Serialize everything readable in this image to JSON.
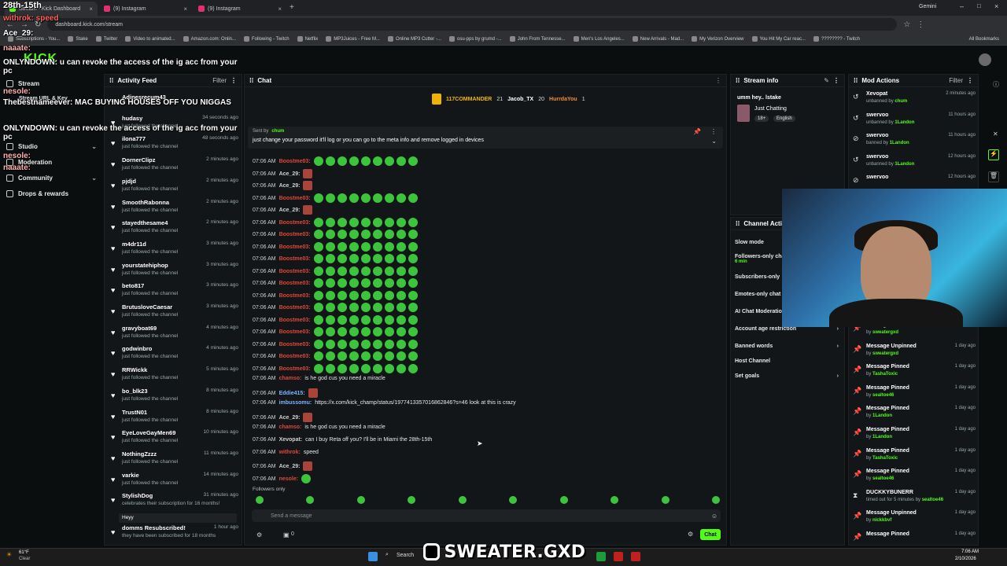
{
  "browser": {
    "tabs": [
      {
        "label": "Stream - Kick Dashboard"
      },
      {
        "label": "(9) Instagram"
      },
      {
        "label": "(9) Instagram"
      }
    ],
    "gemini_label": "Gemini",
    "url": "dashboard.kick.com/stream",
    "bookmarks": [
      "Subscriptions - You...",
      "Stake",
      "Twitter",
      "Video to animated...",
      "Amazon.com: Onlin...",
      "Following - Twitch",
      "Netflix",
      "MP3Juices - Free M...",
      "Online MP3 Cutter -...",
      "osu-pps by grumd -...",
      "John From Tennesse...",
      "Men's Los Angeles...",
      "New Arrivals - Mad...",
      "My Verizon Overview",
      "You Hit My Car reac...",
      "???????? - Twitch"
    ],
    "all_bookmarks": "All Bookmarks"
  },
  "kick": {
    "logo": "KICK"
  },
  "leftnav": {
    "items": [
      {
        "label": "Stream"
      },
      {
        "label": "Stream URL & Key"
      },
      {
        "label": "Studio"
      },
      {
        "label": "Moderation"
      },
      {
        "label": "Community"
      },
      {
        "label": "Drops & rewards"
      }
    ]
  },
  "activity": {
    "title": "Activity Feed",
    "filter": "Filter",
    "items": [
      {
        "name": "Adinesrecum43",
        "sub": "",
        "time": ""
      },
      {
        "name": "hudasy",
        "sub": "just followed the channel",
        "time": "34 seconds ago"
      },
      {
        "name": "ilona777",
        "sub": "just followed the channel",
        "time": "48 seconds ago"
      },
      {
        "name": "DornerClipz",
        "sub": "just followed the channel",
        "time": "2 minutes ago"
      },
      {
        "name": "pjdjd",
        "sub": "just followed the channel",
        "time": "2 minutes ago"
      },
      {
        "name": "SmoothRabonna",
        "sub": "just followed the channel",
        "time": "2 minutes ago"
      },
      {
        "name": "stayedthesame4",
        "sub": "just followed the channel",
        "time": "2 minutes ago"
      },
      {
        "name": "m4dr11d",
        "sub": "just followed the channel",
        "time": "3 minutes ago"
      },
      {
        "name": "yourstatehiphop",
        "sub": "just followed the channel",
        "time": "3 minutes ago"
      },
      {
        "name": "beto817",
        "sub": "just followed the channel",
        "time": "3 minutes ago"
      },
      {
        "name": "BrutusloveCaesar",
        "sub": "just followed the channel",
        "time": "3 minutes ago"
      },
      {
        "name": "gravyboat69",
        "sub": "just followed the channel",
        "time": "4 minutes ago"
      },
      {
        "name": "godwinbro",
        "sub": "just followed the channel",
        "time": "4 minutes ago"
      },
      {
        "name": "RRWickk",
        "sub": "just followed the channel",
        "time": "5 minutes ago"
      },
      {
        "name": "bo_blk23",
        "sub": "just followed the channel",
        "time": "8 minutes ago"
      },
      {
        "name": "TrustN01",
        "sub": "just followed the channel",
        "time": "8 minutes ago"
      },
      {
        "name": "EyeLoveGayMen69",
        "sub": "just followed the channel",
        "time": "10 minutes ago"
      },
      {
        "name": "NothingZzzz",
        "sub": "just followed the channel",
        "time": "11 minutes ago"
      },
      {
        "name": "varkie",
        "sub": "just followed the channel",
        "time": "14 minutes ago"
      },
      {
        "name": "StylishDog",
        "sub": "celebrates their subscription for 16 months!",
        "time": "31 minutes ago"
      },
      {
        "name": "domms Resubscribed!",
        "sub": "they have been subscribed for 18 months",
        "time": "1 hour ago"
      }
    ],
    "stylishdog_msg": "Heyy"
  },
  "chat": {
    "title": "Chat",
    "top_users": [
      {
        "name": "117COMMANDER",
        "count": "21"
      },
      {
        "name": "Jacob_TX",
        "count": "20"
      },
      {
        "name": "HurrdaYou",
        "count": "1"
      }
    ],
    "pinned_by": "Sent by",
    "pinned_user": "chum",
    "pinned_text": "just change your password it'll log or you can go to the meta info and remove logged in devices",
    "messages": [
      {
        "time": "07:06 AM",
        "user": "Boostme03:",
        "text": "",
        "emotes": 9,
        "kind": "emo",
        "color": "#e0463a"
      },
      {
        "time": "07:06 AM",
        "user": "Ace_29:",
        "text": "",
        "emotes": 1,
        "kind": "box",
        "color": "#cfcfcf"
      },
      {
        "time": "07:06 AM",
        "user": "Ace_29:",
        "text": "",
        "emotes": 1,
        "kind": "box",
        "color": "#cfcfcf"
      },
      {
        "time": "07:06 AM",
        "user": "Boostme03:",
        "text": "",
        "emotes": 9,
        "kind": "emo",
        "color": "#e0463a"
      },
      {
        "time": "07:06 AM",
        "user": "Ace_29:",
        "text": "",
        "emotes": 1,
        "kind": "box",
        "color": "#cfcfcf"
      },
      {
        "time": "07:06 AM",
        "user": "Boostme03:",
        "text": "",
        "emotes": 9,
        "kind": "emo",
        "color": "#e0463a"
      },
      {
        "time": "07:06 AM",
        "user": "Boostme03:",
        "text": "",
        "emotes": 9,
        "kind": "emo",
        "color": "#e0463a"
      },
      {
        "time": "07:06 AM",
        "user": "Boostme03:",
        "text": "",
        "emotes": 9,
        "kind": "emo",
        "color": "#e0463a"
      },
      {
        "time": "07:06 AM",
        "user": "Boostme03:",
        "text": "",
        "emotes": 9,
        "kind": "emo",
        "color": "#e0463a"
      },
      {
        "time": "07:06 AM",
        "user": "Boostme03:",
        "text": "",
        "emotes": 9,
        "kind": "emo",
        "color": "#e0463a"
      },
      {
        "time": "07:06 AM",
        "user": "Boostme03:",
        "text": "",
        "emotes": 9,
        "kind": "emo",
        "color": "#e0463a"
      },
      {
        "time": "07:06 AM",
        "user": "Boostme03:",
        "text": "",
        "emotes": 9,
        "kind": "emo",
        "color": "#e0463a"
      },
      {
        "time": "07:06 AM",
        "user": "Boostme03:",
        "text": "",
        "emotes": 9,
        "kind": "emo",
        "color": "#e0463a"
      },
      {
        "time": "07:06 AM",
        "user": "Boostme03:",
        "text": "",
        "emotes": 9,
        "kind": "emo",
        "color": "#e0463a"
      },
      {
        "time": "07:06 AM",
        "user": "Boostme03:",
        "text": "",
        "emotes": 9,
        "kind": "emo",
        "color": "#e0463a"
      },
      {
        "time": "07:06 AM",
        "user": "Boostme03:",
        "text": "",
        "emotes": 9,
        "kind": "emo",
        "color": "#e0463a"
      },
      {
        "time": "07:06 AM",
        "user": "Boostme03:",
        "text": "",
        "emotes": 9,
        "kind": "emo",
        "color": "#e0463a"
      },
      {
        "time": "07:06 AM",
        "user": "Boostme03:",
        "text": "",
        "emotes": 9,
        "kind": "emo",
        "color": "#e0463a"
      },
      {
        "time": "07:06 AM",
        "user": "chamso:",
        "text": "is he god cus you need a miracle",
        "emotes": 0,
        "kind": "",
        "color": "#e0463a"
      },
      {
        "time": "07:06 AM",
        "user": "Eddie415:",
        "text": "",
        "emotes": 1,
        "kind": "box",
        "color": "#7fb2ff"
      },
      {
        "time": "07:06 AM",
        "user": "imbussomu:",
        "text": "https://x.com/kick_champ/status/1977413357016862846?s=46 look at this is crazy",
        "emotes": 0,
        "kind": "",
        "color": "#7fb2ff"
      },
      {
        "time": "07:06 AM",
        "user": "Ace_29:",
        "text": "",
        "emotes": 1,
        "kind": "box",
        "color": "#cfcfcf"
      },
      {
        "time": "07:06 AM",
        "user": "chamso:",
        "text": "is he god cus you need a miracle",
        "emotes": 0,
        "kind": "",
        "color": "#e0463a"
      },
      {
        "time": "07:06 AM",
        "user": "Xevopat:",
        "text": "can I buy Reta off you? I'll be in Miami the 28th-15th",
        "emotes": 0,
        "kind": "",
        "color": "#cfcfcf"
      },
      {
        "time": "07:06 AM",
        "user": "withrok:",
        "text": "speed",
        "emotes": 0,
        "kind": "",
        "color": "#e0463a"
      },
      {
        "time": "07:06 AM",
        "user": "Ace_29:",
        "text": "",
        "emotes": 1,
        "kind": "box",
        "color": "#cfcfcf"
      },
      {
        "time": "07:06 AM",
        "user": "nesole:",
        "text": "",
        "emotes": 1,
        "kind": "emo",
        "color": "#e0463a"
      }
    ],
    "followers_only": "Followers only",
    "input_placeholder": "Send a message",
    "send_label": "Chat",
    "count": "0"
  },
  "streaminfo": {
    "title": "Stream info",
    "stream_title": "umm hey.. lstake",
    "category": "Just Chatting",
    "tag1": "18+",
    "tag2": "English"
  },
  "channelactions": {
    "title": "Channel Actions",
    "items": [
      {
        "label": "Slow mode",
        "sub": ""
      },
      {
        "label": "Followers-only chat",
        "sub": "6 min"
      },
      {
        "label": "Subscribers-only",
        "sub": ""
      },
      {
        "label": "Emotes-only chat",
        "sub": ""
      },
      {
        "label": "AI Chat Moderation",
        "sub": ""
      },
      {
        "label": "Account age restriction",
        "sub": ""
      },
      {
        "label": "Banned words",
        "sub": ""
      },
      {
        "label": "Host Channel",
        "sub": ""
      },
      {
        "label": "Set goals",
        "sub": ""
      }
    ]
  },
  "modactions": {
    "title": "Mod Actions",
    "filter": "Filter",
    "items": [
      {
        "icon": "undo",
        "name": "Xevopat",
        "verb": "unbanned by",
        "by": "chum",
        "time": "2 minutes ago"
      },
      {
        "icon": "undo",
        "name": "swervoo",
        "verb": "unbanned by",
        "by": "1Landon",
        "time": "11 hours ago"
      },
      {
        "icon": "ban",
        "name": "swervoo",
        "verb": "banned by",
        "by": "1Landon",
        "time": "11 hours ago"
      },
      {
        "icon": "undo",
        "name": "swervoo",
        "verb": "unbanned by",
        "by": "1Landon",
        "time": "12 hours ago"
      },
      {
        "icon": "ban",
        "name": "swervoo",
        "verb": "",
        "by": "",
        "time": "12 hours ago"
      },
      {
        "icon": "pin",
        "name": "Message Pinned",
        "verb": "by",
        "by": "sweatergxd",
        "time": "1 day ago"
      },
      {
        "icon": "pin",
        "name": "Message Unpinned",
        "verb": "by",
        "by": "sweatergxd",
        "time": "1 day ago"
      },
      {
        "icon": "pin",
        "name": "Message Pinned",
        "verb": "by",
        "by": "TashaToxic",
        "time": "1 day ago"
      },
      {
        "icon": "pin",
        "name": "Message Pinned",
        "verb": "by",
        "by": "sealtoe46",
        "time": "1 day ago"
      },
      {
        "icon": "pin",
        "name": "Message Pinned",
        "verb": "by",
        "by": "1Landon",
        "time": "1 day ago"
      },
      {
        "icon": "pin",
        "name": "Message Pinned",
        "verb": "by",
        "by": "1Landon",
        "time": "1 day ago"
      },
      {
        "icon": "pin",
        "name": "Message Pinned",
        "verb": "by",
        "by": "TashaToxic",
        "time": "1 day ago"
      },
      {
        "icon": "pin",
        "name": "Message Pinned",
        "verb": "by",
        "by": "sealtoe46",
        "time": "1 day ago"
      },
      {
        "icon": "timeout",
        "name": "DUCKKYBUNERR",
        "verb": "timed out for 5 minutes by",
        "by": "sealtoe46",
        "time": "1 day ago"
      },
      {
        "icon": "pin",
        "name": "Message Unpinned",
        "verb": "by",
        "by": "nickkbvf",
        "time": "1 day ago"
      },
      {
        "icon": "pin",
        "name": "Message Pinned",
        "verb": "",
        "by": "",
        "time": "1 day ago"
      }
    ]
  },
  "overlay": {
    "line1": "28th-15th",
    "line2": "withrok: speed",
    "line3": "Ace_29:",
    "line4": "ONLYNDOWN: u can revoke the access of the ig acc from your pc",
    "line5": "nesole:",
    "line6": "Thebestnameever: MAC BUYING HOUSES OFF YOU NIGGAS",
    "line7": "ONLYNDOWN: u can revoke the access of the ig acc from your pc",
    "line8": "nesole:",
    "line9": "naaate:",
    "line10": "naaate:"
  },
  "brand": {
    "text": "SWEATER.GXD"
  },
  "taskbar": {
    "weather": "61°F",
    "weather_sub": "Clear",
    "search": "Search",
    "time": "7:06 AM",
    "date": "2/10/2026"
  },
  "colors": {
    "accent": "#53fc18",
    "panel": "#131618",
    "bg": "#0b0e0f"
  }
}
